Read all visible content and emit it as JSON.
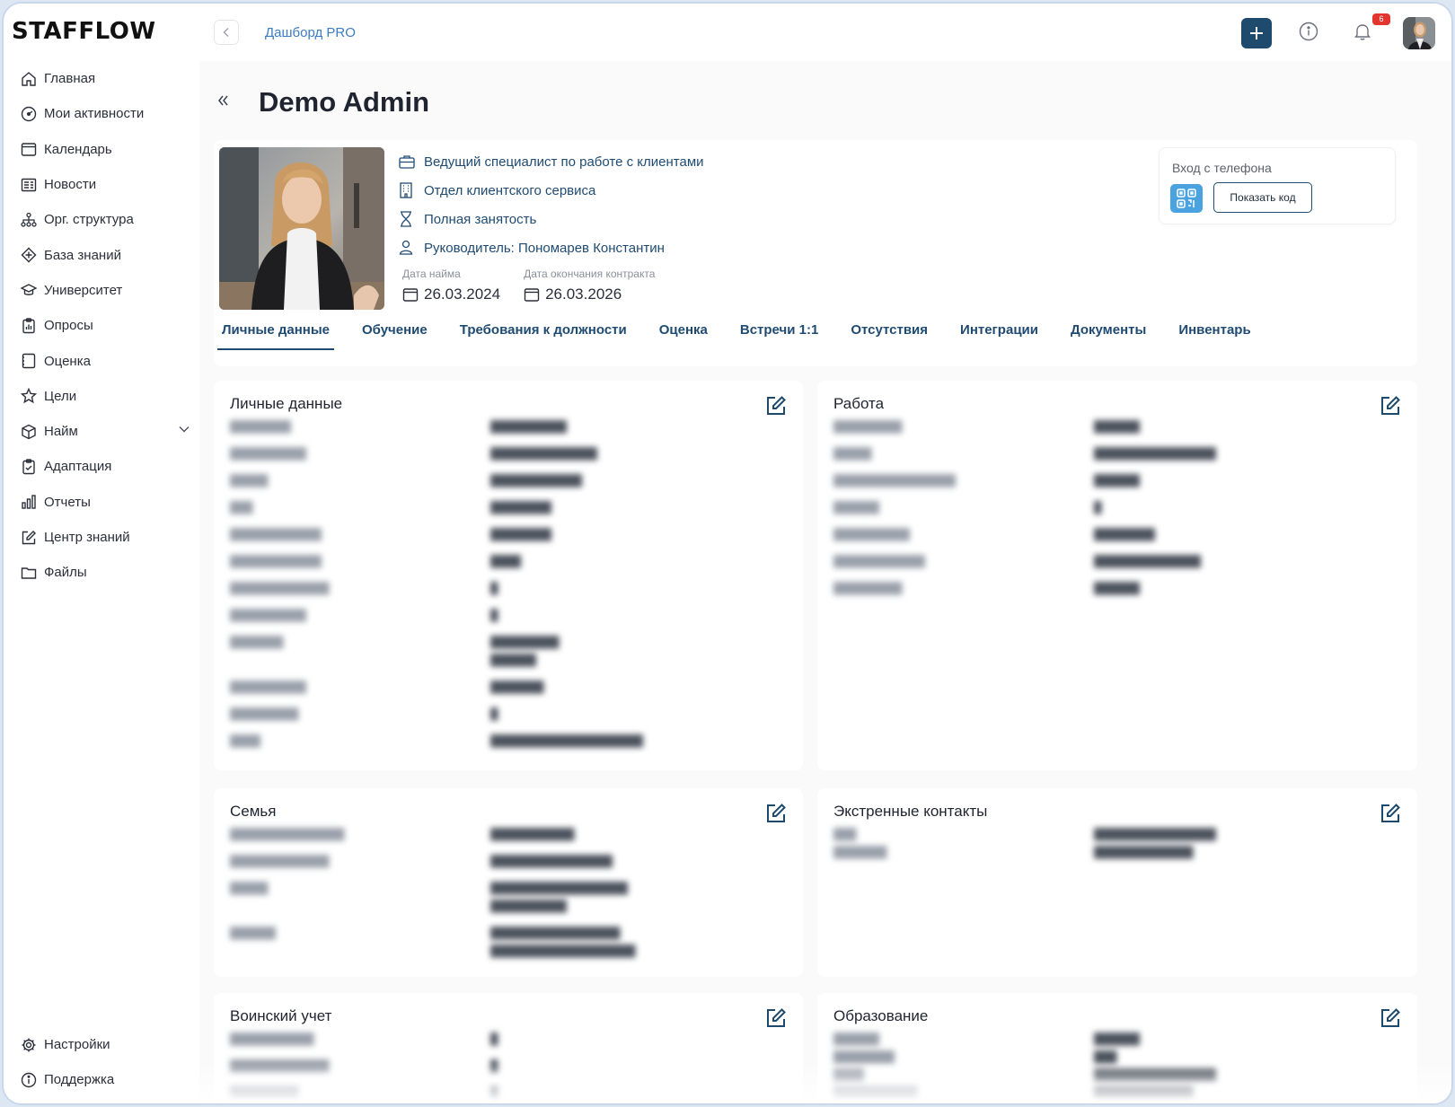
{
  "app": {
    "logo": "STAFFLOW"
  },
  "sidebar": {
    "items": [
      {
        "label": "Главная",
        "icon": "home-icon"
      },
      {
        "label": "Мои активности",
        "icon": "gauge-icon"
      },
      {
        "label": "Календарь",
        "icon": "calendar-icon"
      },
      {
        "label": "Новости",
        "icon": "news-icon"
      },
      {
        "label": "Орг. структура",
        "icon": "org-structure-icon"
      },
      {
        "label": "База знаний",
        "icon": "knowledge-base-icon"
      },
      {
        "label": "Университет",
        "icon": "graduation-cap-icon"
      },
      {
        "label": "Опросы",
        "icon": "survey-icon"
      },
      {
        "label": "Оценка",
        "icon": "evaluation-icon"
      },
      {
        "label": "Цели",
        "icon": "star-icon"
      },
      {
        "label": "Найм",
        "icon": "box-icon"
      },
      {
        "label": "Адаптация",
        "icon": "clipboard-icon"
      },
      {
        "label": "Отчеты",
        "icon": "bar-chart-icon"
      },
      {
        "label": "Центр знаний",
        "icon": "edit-icon"
      },
      {
        "label": "Файлы",
        "icon": "folder-icon"
      }
    ],
    "bottom": [
      {
        "label": "Настройки",
        "icon": "gear-icon"
      },
      {
        "label": "Поддержка",
        "icon": "info-icon"
      }
    ]
  },
  "topbar": {
    "breadcrumb": "Дашборд PRO",
    "notifications_count": "6"
  },
  "profile": {
    "name": "Demo Admin",
    "position": "Ведущий специалист по работе с клиентами",
    "department": "Отдел клиентского сервиса",
    "employment": "Полная занятость",
    "manager": "Руководитель: Пономарев Константин",
    "hire_date_label": "Дата найма",
    "hire_date": "26.03.2024",
    "contract_end_label": "Дата окончания контракта",
    "contract_end": "26.03.2026"
  },
  "phone_login": {
    "label": "Вход с телефона",
    "button": "Показать код"
  },
  "tabs": [
    "Личные данные",
    "Обучение",
    "Требования к должности",
    "Оценка",
    "Встречи 1:1",
    "Отсутствия",
    "Интеграции",
    "Документы",
    "Инвентарь"
  ],
  "panels": {
    "personal": {
      "title": "Личные данные"
    },
    "work": {
      "title": "Работа"
    },
    "family": {
      "title": "Семья"
    },
    "emergency": {
      "title": "Экстренные контакты"
    },
    "military": {
      "title": "Воинский учет"
    },
    "education": {
      "title": "Образование"
    }
  },
  "colors": {
    "accent": "#1d4a6d",
    "link": "#3d7dc0",
    "badge": "#e2352f",
    "qr": "#4aa3df"
  }
}
